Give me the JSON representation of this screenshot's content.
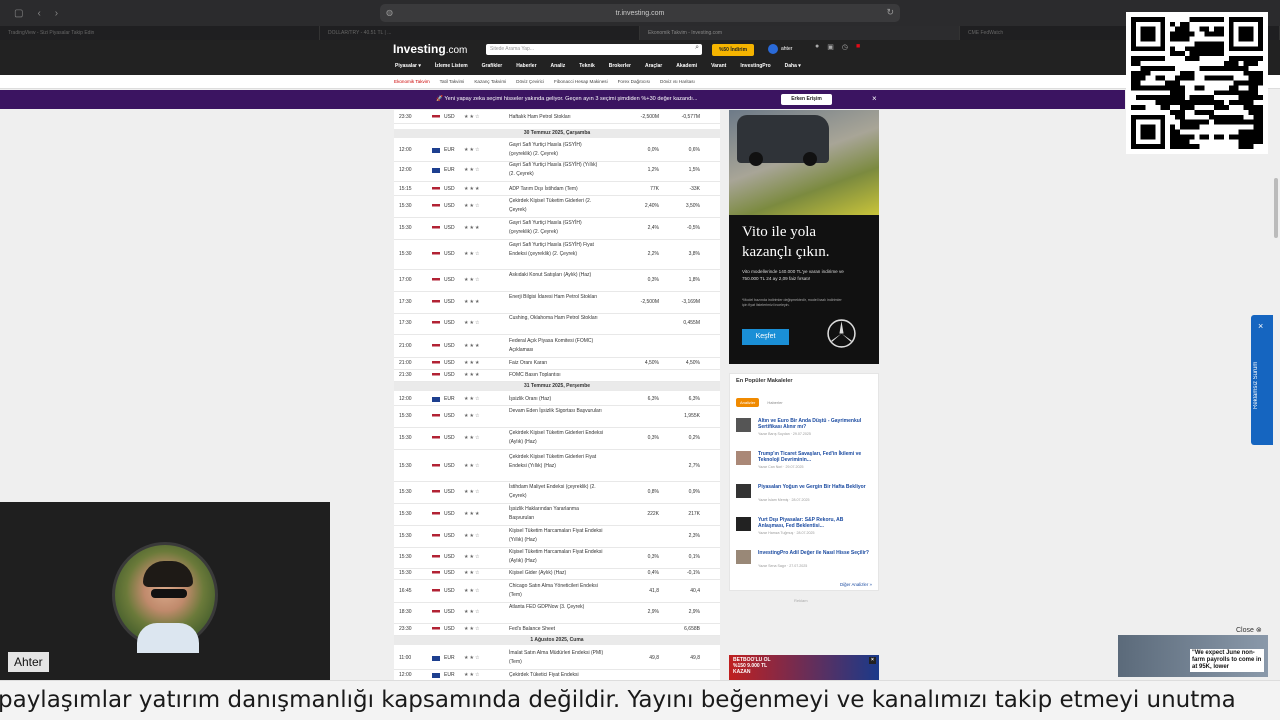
{
  "browser": {
    "url": "tr.investing.com",
    "tabs": [
      "TradingView - Sizi Piyasalar Takip Edin",
      "DOLLAR/TRY - 40.51 TL | ...",
      "Ekonomik Takvim - Investing.com",
      "CME FedWatch"
    ]
  },
  "site": {
    "logo": "Investing",
    "logo_suffix": ".com",
    "search_placeholder": "Sitede Arama Yap...",
    "promo": "%50 İndirim",
    "user_name": "ahter",
    "nav": [
      "Piyasalar ▾",
      "İzleme Listem",
      "Grafikler",
      "Haberler",
      "Analiz",
      "Teknik",
      "Brokerler",
      "Araçlar",
      "Akademi",
      "Varant",
      "InvestingPro",
      "Daha ▾"
    ],
    "subnav": [
      "Ekonomik Takvim",
      "Tatil Takvimi",
      "Kazanç Takvimi",
      "Döviz Çevirici",
      "Fibonacci Hesap Makinesi",
      "Forex Dağıtıcısı",
      "Döviz ısı Haritası"
    ]
  },
  "banner": {
    "text": "🚀 Yeni yapay zeka seçimi hisseler yakında geliyor. Geçen ayın 3 seçimi şimdiden %+30 değer kazandı...",
    "button": "Erken Erişim",
    "close": "×"
  },
  "calendar": {
    "days": {
      "d1": "30 Temmuz 2025, Çarşamba",
      "d2": "31 Temmuz 2025, Perşembe",
      "d3": "1 Ağustos 2025, Cuma"
    },
    "rows": [
      {
        "time": "23:30",
        "cur": "USD",
        "stars": "★★☆",
        "event": "Haftalık Ham Petrol Stokları",
        "actual": "-2,500M",
        "prev": "-0,577M"
      },
      {
        "time": "12:00",
        "cur": "EUR",
        "stars": "★★☆",
        "event": "Gayri Safi Yurtiçi Hasıla (GSYİH) (çeyreklik) (2. Çeyrek)",
        "actual": "0,0%",
        "prev": "0,6%"
      },
      {
        "time": "12:00",
        "cur": "EUR",
        "stars": "★★☆",
        "event": "Gayri Safi Yurtiçi Hasıla (GSYİH) (Yıllık) (2. Çeyrek)",
        "actual": "1,2%",
        "prev": "1,5%"
      },
      {
        "time": "15:15",
        "cur": "USD",
        "stars": "★★★",
        "event": "ADP Tarım Dışı İstihdam (Tem)",
        "actual": "77K",
        "prev": "-33K"
      },
      {
        "time": "15:30",
        "cur": "USD",
        "stars": "★★☆",
        "event": "Çekirdek Kişisel Tüketim Giderleri (2. Çeyrek)",
        "actual": "2,40%",
        "prev": "3,50%"
      },
      {
        "time": "15:30",
        "cur": "USD",
        "stars": "★★★",
        "event": "Gayri Safi Yurtiçi Hasıla (GSYİH) (çeyreklik) (2. Çeyrek)",
        "actual": "2,4%",
        "prev": "-0,5%"
      },
      {
        "time": "15:30",
        "cur": "USD",
        "stars": "★★☆",
        "event": "Gayri Safi Yurtiçi Hasıla (GSYİH) Fiyat Endeksi (çeyreklik) (2. Çeyrek)",
        "actual": "2,2%",
        "prev": "3,8%"
      },
      {
        "time": "17:00",
        "cur": "USD",
        "stars": "★★☆",
        "event": "Askıdaki Konut Satışları (Aylık) (Haz)",
        "actual": "0,3%",
        "prev": "1,8%"
      },
      {
        "time": "17:30",
        "cur": "USD",
        "stars": "★★★",
        "event": "Enerji Bilgisi İdaresi Ham Petrol Stokları",
        "actual": "-2,500M",
        "prev": "-3,169M"
      },
      {
        "time": "17:30",
        "cur": "USD",
        "stars": "★★☆",
        "event": "Cushing, Oklahoma Ham Petrol Stokları",
        "actual": "",
        "prev": "0,455M"
      },
      {
        "time": "21:00",
        "cur": "USD",
        "stars": "★★★",
        "event": "Federal Açık Piyasa Komitesi (FOMC) Açıklaması",
        "actual": "",
        "prev": ""
      },
      {
        "time": "21:00",
        "cur": "USD",
        "stars": "★★★",
        "event": "Faiz Oranı Kararı",
        "actual": "4,50%",
        "prev": "4,50%"
      },
      {
        "time": "21:30",
        "cur": "USD",
        "stars": "★★★",
        "event": "FOMC Basın Toplantısı",
        "actual": "",
        "prev": ""
      },
      {
        "time": "12:00",
        "cur": "EUR",
        "stars": "★★☆",
        "event": "İşsizlik Oranı (Haz)",
        "actual": "6,3%",
        "prev": "6,3%"
      },
      {
        "time": "15:30",
        "cur": "USD",
        "stars": "★★☆",
        "event": "Devam Eden İşsizlik Sigortası Başvuruları",
        "actual": "",
        "prev": "1,955K"
      },
      {
        "time": "15:30",
        "cur": "USD",
        "stars": "★★☆",
        "event": "Çekirdek Kişisel Tüketim Giderleri Endeksi (Aylık) (Haz)",
        "actual": "0,3%",
        "prev": "0,2%"
      },
      {
        "time": "15:30",
        "cur": "USD",
        "stars": "★★☆",
        "event": "Çekirdek Kişisel Tüketim Giderleri Fiyat Endeksi (Yıllık) (Haz)",
        "actual": "",
        "prev": "2,7%"
      },
      {
        "time": "15:30",
        "cur": "USD",
        "stars": "★★☆",
        "event": "İstihdam Maliyet Endeksi (çeyreklik) (2. Çeyrek)",
        "actual": "0,8%",
        "prev": "0,9%"
      },
      {
        "time": "15:30",
        "cur": "USD",
        "stars": "★★★",
        "event": "İşsizlik Haklarından Yararlanma Başvuruları",
        "actual": "222K",
        "prev": "217K"
      },
      {
        "time": "15:30",
        "cur": "USD",
        "stars": "★★☆",
        "event": "Kişisel Tüketim Harcamaları Fiyat Endeksi (Yıllık) (Haz)",
        "actual": "",
        "prev": "2,3%"
      },
      {
        "time": "15:30",
        "cur": "USD",
        "stars": "★★☆",
        "event": "Kişisel Tüketim Harcamaları Fiyat Endeksi (Aylık) (Haz)",
        "actual": "0,3%",
        "prev": "0,1%"
      },
      {
        "time": "15:30",
        "cur": "USD",
        "stars": "★★☆",
        "event": "Kişisel Gider (Aylık) (Haz)",
        "actual": "0,4%",
        "prev": "-0,1%"
      },
      {
        "time": "16:45",
        "cur": "USD",
        "stars": "★★☆",
        "event": "Chicago Satın Alma Yöneticileri Endeksi (Tem)",
        "actual": "41,8",
        "prev": "40,4"
      },
      {
        "time": "18:30",
        "cur": "USD",
        "stars": "★★☆",
        "event": "Atlanta FED GDPNow (3. Çeyrek)",
        "actual": "2,9%",
        "prev": "2,9%"
      },
      {
        "time": "23:30",
        "cur": "USD",
        "stars": "★★☆",
        "event": "Fed's Balance Sheet",
        "actual": "",
        "prev": "6,658B"
      },
      {
        "time": "11:00",
        "cur": "EUR",
        "stars": "★★☆",
        "event": "İmalat Satın Alma Müdürleri Endeksi (PMI) (Tem)",
        "actual": "49,8",
        "prev": "49,8"
      },
      {
        "time": "12:00",
        "cur": "EUR",
        "stars": "★★☆",
        "event": "Çekirdek Tüketici Fiyat Endeksi",
        "actual": "",
        "prev": ""
      }
    ]
  },
  "ad": {
    "title_line1": "Vito ile yola",
    "title_line2": "kazançlı çıkın.",
    "body": "Vito modellerinde 140.000 TL'ye varan indirime ve 750.000 TL 24 ay 2,09 faiz fırsatı!",
    "note": "*Model bazında indirimler değişmektedir, model bazlı indirimler için fiyat listelerimizi inceleyin.",
    "button": "Keşfet"
  },
  "popular": {
    "title": "En Popüler Makaleler",
    "tab_a": "Analizler",
    "tab_b": "Haberler",
    "articles": [
      {
        "title": "Altın ve Euro Bir Anda Düştü - Gayrimenkul Sertifikası Alınır mı?",
        "meta": "Yazar Barış Soydan · 29.07.2025"
      },
      {
        "title": "Trump'ın Ticaret Savaşları, Fed'in İkilemi ve Teknoloji Devriminin...",
        "meta": "Yazar Can Nori · 29.07.2025"
      },
      {
        "title": "Piyasaları Yoğun ve Gergin Bir Hafta Bekliyor",
        "meta": "Yazar İslam Memiş · 28.07.2025"
      },
      {
        "title": "Yurt Dışı Piyasalar: S&P Rekoru, AB Anlaşması, Fed Beklentisi...",
        "meta": "Yazar Hamza Tuğmuş · 28.07.2025"
      },
      {
        "title": "InvestingPro Adil Değer ile Nasıl Hisse Seçilir?",
        "meta": "Yazar Sena Sagır · 27.07.2025"
      }
    ],
    "more": "Diğer Analizler »",
    "ad_label": "Reklam"
  },
  "bottom_ad": {
    "line1": "BETBOO'LU OL",
    "line2": "%150 9.000 TL",
    "line3": "KAZAN"
  },
  "side_tab": {
    "text": "Reklamsız Sürüm",
    "close": "×"
  },
  "mini_player": {
    "close": "Close ⊗",
    "text": "\"We expect June non-farm payrolls to come in at 95K, lower"
  },
  "webcam": {
    "name": "Ahter"
  },
  "ticker": {
    "text": "paylaşımlar yatırım danışmanlığı kapsamında değildir. Yayını beğenmeyi ve kanalımızı takip etmeyi unutma"
  },
  "colors": {
    "banner": "#3b1461",
    "promo": "#f5b400",
    "link": "#1a4aa0",
    "side_tab": "#1565c0"
  }
}
